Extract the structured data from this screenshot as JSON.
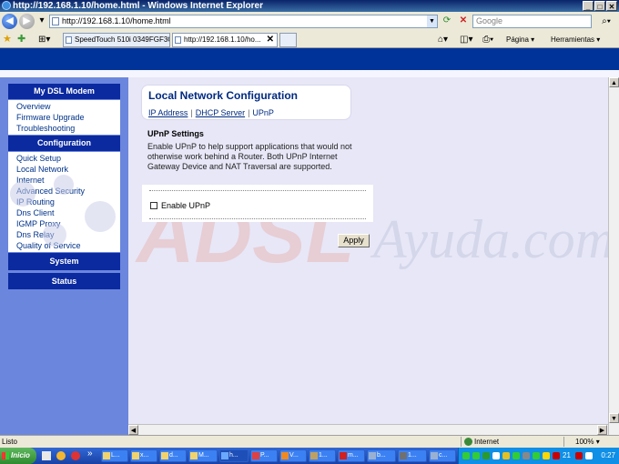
{
  "window": {
    "title": "http://192.168.1.10/home.html - Windows Internet Explorer"
  },
  "addressbar": {
    "url": "http://192.168.1.10/home.html",
    "search_placeholder": "Google"
  },
  "tabs": [
    {
      "label": "SpeedTouch 510i  0349FGF3G"
    },
    {
      "label": "http://192.168.1.10/ho...",
      "active": true
    }
  ],
  "toolbar": {
    "page_label": "Página",
    "tools_label": "Herramientas"
  },
  "sidebar": {
    "sections": [
      {
        "title": "My DSL Modem",
        "items": [
          "Overview",
          "Firmware Upgrade",
          "Troubleshooting"
        ]
      },
      {
        "title": "Configuration",
        "items": [
          "Quick Setup",
          "Local Network",
          "Internet",
          "Advanced Security",
          "IP Routing",
          "Dns Client",
          "IGMP Proxy",
          "Dns Relay",
          "Quality of Service"
        ]
      },
      {
        "title": "System",
        "items": []
      },
      {
        "title": "Status",
        "items": []
      }
    ]
  },
  "main": {
    "title": "Local Network Configuration",
    "subnav": [
      "IP Address",
      "DHCP Server",
      "UPnP"
    ],
    "section_heading": "UPnP Settings",
    "description": "Enable UPnP to help support applications that would not otherwise work behind a Router. Both UPnP Internet Gateway Device and NAT Traversal are supported.",
    "checkbox_label": "Enable UPnP",
    "checkbox_checked": false,
    "apply_label": "Apply"
  },
  "watermark": {
    "text_bold": "ADSL",
    "text_script": "Ayuda.com"
  },
  "statusbar": {
    "text": "Listo",
    "zone": "Internet",
    "zoom": "100%"
  },
  "taskbar": {
    "start_label": "Inicio",
    "chevron": "»",
    "tasks": [
      "L...",
      "x...",
      "d...",
      "M...",
      "h...",
      "P...",
      "V...",
      "1...",
      "m...",
      "b...",
      "1...",
      "c..."
    ],
    "active_task_index": 4,
    "tray_numbers": "21",
    "clock": "0:27"
  },
  "colors": {
    "brand_dark": "#003399",
    "menu_header": "#0b2aa0",
    "sidebar_bg": "#6b86dd",
    "main_bg": "#e7e7f7",
    "link": "#002a80"
  }
}
